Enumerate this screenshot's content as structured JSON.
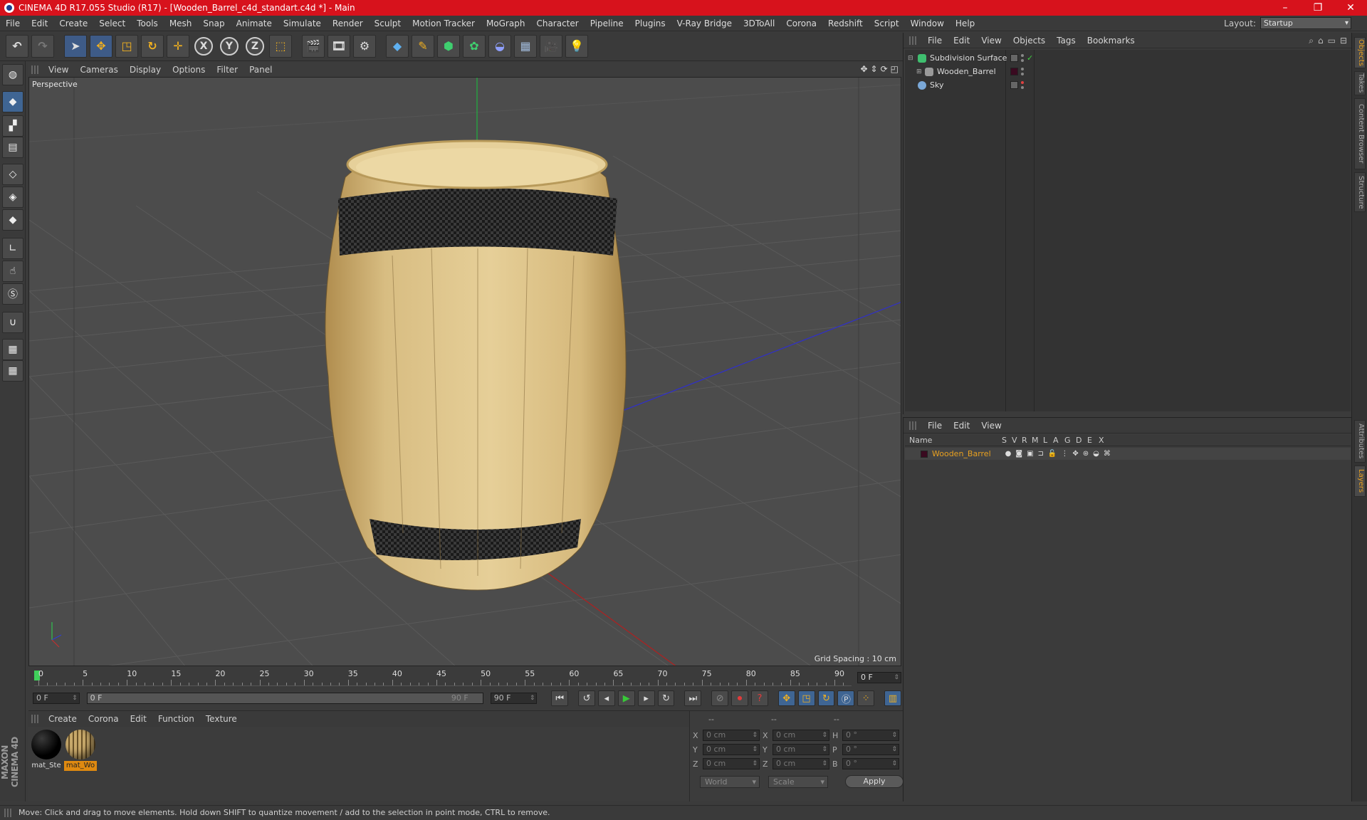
{
  "window": {
    "title": "CINEMA 4D R17.055 Studio (R17) - [Wooden_Barrel_c4d_standart.c4d *] - Main",
    "controls": [
      "–",
      "❐",
      "✕"
    ]
  },
  "menu": {
    "items": [
      "File",
      "Edit",
      "Create",
      "Select",
      "Tools",
      "Mesh",
      "Snap",
      "Animate",
      "Simulate",
      "Render",
      "Sculpt",
      "Motion Tracker",
      "MoGraph",
      "Character",
      "Pipeline",
      "Plugins",
      "V-Ray Bridge",
      "3DToAll",
      "Corona",
      "Redshift",
      "Script",
      "Window",
      "Help"
    ],
    "layout_label": "Layout:",
    "layout_value": "Startup"
  },
  "toolbar": {
    "x_label": "X",
    "y_label": "Y",
    "z_label": "Z"
  },
  "viewport": {
    "menu": [
      "View",
      "Cameras",
      "Display",
      "Options",
      "Filter",
      "Panel"
    ],
    "camera_label": "Perspective",
    "grid_spacing": "Grid Spacing : 10 cm"
  },
  "timeline": {
    "ticks": [
      "0",
      "5",
      "10",
      "15",
      "20",
      "25",
      "30",
      "35",
      "40",
      "45",
      "50",
      "55",
      "60",
      "65",
      "70",
      "75",
      "80",
      "85",
      "90"
    ],
    "current_frame": "0 F",
    "start_field": "0 F",
    "range_start": "0 F",
    "range_end": "90 F",
    "end_field": "90 F"
  },
  "materials": {
    "menu": [
      "Create",
      "Corona",
      "Edit",
      "Function",
      "Texture"
    ],
    "items": [
      {
        "name": "mat_Ste",
        "selected": false,
        "color": "#0a0a0a"
      },
      {
        "name": "mat_Wo",
        "selected": true,
        "color": "#c8a96b"
      }
    ]
  },
  "coordinates": {
    "header": [
      "--",
      "--",
      "--"
    ],
    "rows": [
      {
        "a": "X",
        "v1": "0 cm",
        "b": "X",
        "v2": "0 cm",
        "c": "H",
        "v3": "0 °"
      },
      {
        "a": "Y",
        "v1": "0 cm",
        "b": "Y",
        "v2": "0 cm",
        "c": "P",
        "v3": "0 °"
      },
      {
        "a": "Z",
        "v1": "0 cm",
        "b": "Z",
        "v2": "0 cm",
        "c": "B",
        "v3": "0 °"
      }
    ],
    "mode1": "World",
    "mode2": "Scale",
    "apply": "Apply"
  },
  "objects": {
    "menu": [
      "File",
      "Edit",
      "View",
      "Objects",
      "Tags",
      "Bookmarks"
    ],
    "tree": [
      {
        "name": "Subdivision Surface",
        "icon_color": "#3fbf6f"
      },
      {
        "name": "Wooden_Barrel",
        "icon_color": "#bbbbbb"
      },
      {
        "name": "Sky",
        "icon_color": "#7aa8d8"
      }
    ]
  },
  "layers": {
    "menu": [
      "File",
      "Edit",
      "View"
    ],
    "columns": [
      "Name",
      "S",
      "V",
      "R",
      "M",
      "L",
      "A",
      "G",
      "D",
      "E",
      "X"
    ],
    "rows": [
      {
        "name": "Wooden_Barrel",
        "color": "#e8a020"
      }
    ]
  },
  "side_tabs": {
    "top": [
      "Objects",
      "Takes",
      "Content Browser",
      "Structure"
    ],
    "bottom": [
      "Attributes",
      "Layers"
    ]
  },
  "brand": "MAXON CINEMA 4D",
  "status": "Move: Click and drag to move elements. Hold down SHIFT to quantize movement / add to the selection in point mode, CTRL to remove."
}
